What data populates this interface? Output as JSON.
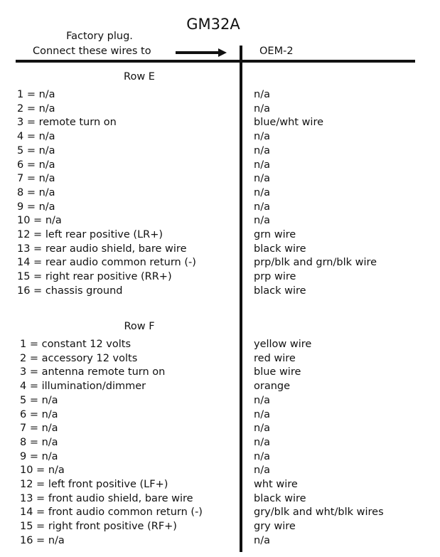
{
  "title": "GM32A",
  "header": {
    "line1": "Factory plug.",
    "line2": "Connect these wires to",
    "right": "OEM-2"
  },
  "sections": [
    {
      "title": "Row E",
      "rows": [
        {
          "pin": "1 = n/a",
          "wire": "n/a"
        },
        {
          "pin": "2 = n/a",
          "wire": "n/a"
        },
        {
          "pin": "3 = remote turn on",
          "wire": "blue/wht wire"
        },
        {
          "pin": "4 = n/a",
          "wire": "n/a"
        },
        {
          "pin": "5 = n/a",
          "wire": "n/a"
        },
        {
          "pin": "6 = n/a",
          "wire": "n/a"
        },
        {
          "pin": "7 = n/a",
          "wire": "n/a"
        },
        {
          "pin": "8 = n/a",
          "wire": "n/a"
        },
        {
          "pin": "9 = n/a",
          "wire": "n/a"
        },
        {
          "pin": "10 = n/a",
          "wire": "n/a"
        },
        {
          "pin": "12 = left rear positive (LR+)",
          "wire": "grn wire"
        },
        {
          "pin": "13 = rear audio shield, bare wire",
          "wire": "black wire"
        },
        {
          "pin": "14 = rear audio common return (-)",
          "wire": "prp/blk and grn/blk wire"
        },
        {
          "pin": "15 = right rear positive (RR+)",
          "wire": "prp wire"
        },
        {
          "pin": "16 = chassis ground",
          "wire": "black wire"
        }
      ]
    },
    {
      "title": "Row F",
      "rows": [
        {
          "pin": "1 = constant 12 volts",
          "wire": "yellow wire"
        },
        {
          "pin": "2 = accessory 12 volts",
          "wire": "red wire"
        },
        {
          "pin": "3 = antenna remote turn on",
          "wire": "blue wire"
        },
        {
          "pin": "4 = illumination/dimmer",
          "wire": "orange"
        },
        {
          "pin": "5 = n/a",
          "wire": "n/a"
        },
        {
          "pin": "6 = n/a",
          "wire": "n/a"
        },
        {
          "pin": "7 = n/a",
          "wire": "n/a"
        },
        {
          "pin": "8 = n/a",
          "wire": "n/a"
        },
        {
          "pin": "9 = n/a",
          "wire": "n/a"
        },
        {
          "pin": "10 = n/a",
          "wire": "n/a"
        },
        {
          "pin": "12 = left front positive (LF+)",
          "wire": "wht wire"
        },
        {
          "pin": "13 = front audio shield, bare wire",
          "wire": "black wire"
        },
        {
          "pin": "14 = front audio common return (-)",
          "wire": "gry/blk and wht/blk wires"
        },
        {
          "pin": "15 = right front positive (RF+)",
          "wire": "gry wire"
        },
        {
          "pin": "16 = n/a",
          "wire": "n/a"
        }
      ]
    }
  ]
}
